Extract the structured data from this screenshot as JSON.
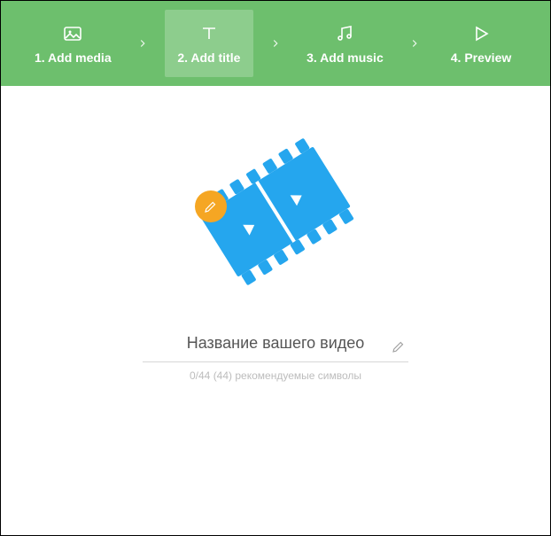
{
  "stepper": {
    "active_index": 1,
    "items": [
      {
        "label": "1. Add media",
        "icon": "image-icon"
      },
      {
        "label": "2. Add title",
        "icon": "text-icon"
      },
      {
        "label": "3. Add music",
        "icon": "music-icon"
      },
      {
        "label": "4. Preview",
        "icon": "play-icon"
      }
    ]
  },
  "title_field": {
    "placeholder": "Название вашего видео",
    "value": "",
    "hint": "0/44 (44) рекомендуемые символы"
  },
  "colors": {
    "stepper_bg": "#6dbf6d",
    "accent_blue": "#25a6ee",
    "accent_cyan": "#2cd0e8",
    "accent_orange": "#f5a623"
  }
}
